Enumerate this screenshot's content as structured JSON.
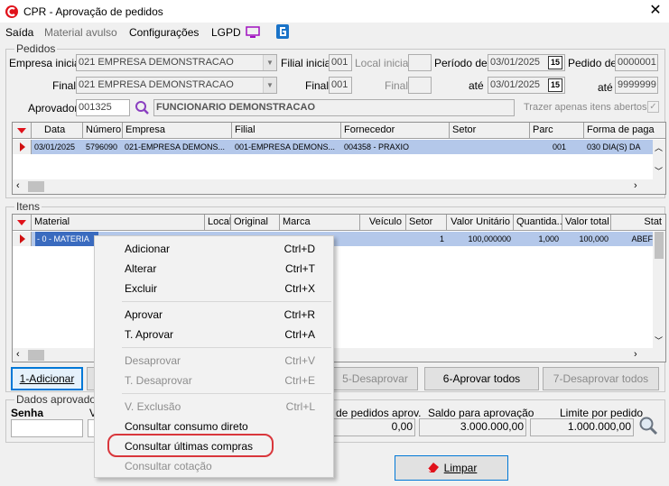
{
  "window": {
    "title": "CPR - Aprovação de pedidos",
    "close_glyph": "✕"
  },
  "menu": {
    "saida": "Saída",
    "material_avulso": "Material avulso",
    "configuracoes": "Configurações",
    "lgpd": "LGPD"
  },
  "pedidos": {
    "group_label": "Pedidos",
    "empresa_inicial_label": "Empresa inicial",
    "empresa_inicial_value": "021 EMPRESA DEMONSTRACAO",
    "filial_inicial_label": "Filial inicial",
    "filial_inicial_value": "001",
    "local_inicial_label": "Local inicial",
    "periodo_de_label": "Período de",
    "periodo_de_value": "03/01/2025",
    "pedido_de_label": "Pedido de",
    "pedido_de_value": "0000001",
    "final_label": "Final",
    "empresa_final_value": "021 EMPRESA DEMONSTRACAO",
    "filial_final_label": "Final",
    "filial_final_value": "001",
    "local_final_label": "Final",
    "ate_label": "até",
    "ate_value": "03/01/2025",
    "pedido_ate_label": "até",
    "pedido_ate_value": "9999999",
    "aprovador_label": "Aprovador",
    "aprovador_code": "001325",
    "aprovador_name": "FUNCIONARIO DEMONSTRACAO",
    "trazer_label": "Trazer apenas itens abertos",
    "cal_glyph": "15",
    "columns": [
      "Data",
      "Número",
      "Empresa",
      "Filial",
      "Fornecedor",
      "Setor",
      "Parc",
      "Forma de paga"
    ],
    "rows": [
      [
        "03/01/2025",
        "5796090",
        "021-EMPRESA DEMONS...",
        "001-EMPRESA DEMONS...",
        "004358 - PRAXIO",
        "",
        "001",
        "030 DIA(S) DA"
      ]
    ]
  },
  "itens": {
    "group_label": "Itens",
    "columns": [
      "Material",
      "Local",
      "Original",
      "Marca",
      "Veículo",
      "Setor",
      "Valor Unitário",
      "Quantida...",
      "Valor total",
      "Stat"
    ],
    "rows": [
      [
        "- 0 - MATERIA",
        "",
        "",
        "",
        "",
        "1",
        "100,000000",
        "1,000",
        "100,000",
        "ABEF"
      ]
    ]
  },
  "buttons": {
    "adicionar": "1-Adicionar",
    "desaprovar": "5-Desaprovar",
    "aprovar_todos": "6-Aprovar todos",
    "desaprovar_todos": "7-Desaprovar todos",
    "limpar": "Limpar"
  },
  "dados": {
    "group_label": "Dados aprovador",
    "senha_label": "Senha",
    "v_label": "V",
    "pedidos_aprov_label": "de pedidos aprov.",
    "pedidos_aprov_value": "0,00",
    "saldo_label": "Saldo para aprovação",
    "saldo_value": "3.000.000,00",
    "limite_label": "Limite por pedido",
    "limite_value": "1.000.000,00"
  },
  "context_menu": [
    {
      "label": "Adicionar",
      "shortcut": "Ctrl+D",
      "enabled": true
    },
    {
      "label": "Alterar",
      "shortcut": "Ctrl+T",
      "enabled": true
    },
    {
      "label": "Excluir",
      "shortcut": "Ctrl+X",
      "enabled": true
    },
    {
      "label": "Aprovar",
      "shortcut": "Ctrl+R",
      "enabled": true
    },
    {
      "label": "T. Aprovar",
      "shortcut": "Ctrl+A",
      "enabled": true
    },
    {
      "label": "Desaprovar",
      "shortcut": "Ctrl+V",
      "enabled": false
    },
    {
      "label": "T. Desaprovar",
      "shortcut": "Ctrl+E",
      "enabled": false
    },
    {
      "label": "V. Exclusão",
      "shortcut": "Ctrl+L",
      "enabled": false
    },
    {
      "label": "Consultar consumo direto",
      "shortcut": "",
      "enabled": true
    },
    {
      "label": "Consultar últimas compras",
      "shortcut": "",
      "enabled": true
    },
    {
      "label": "Consultar cotação",
      "shortcut": "",
      "enabled": false
    }
  ],
  "colors": {
    "accent_red": "#e0121b",
    "selection": "#b4c8ea",
    "highlight_ring": "#d9373c"
  },
  "icons": [
    "app-logo-icon",
    "close-icon",
    "monitor-icon",
    "g-app-icon",
    "search-icon",
    "calendar-icon",
    "eraser-icon",
    "magnifier-icon"
  ]
}
